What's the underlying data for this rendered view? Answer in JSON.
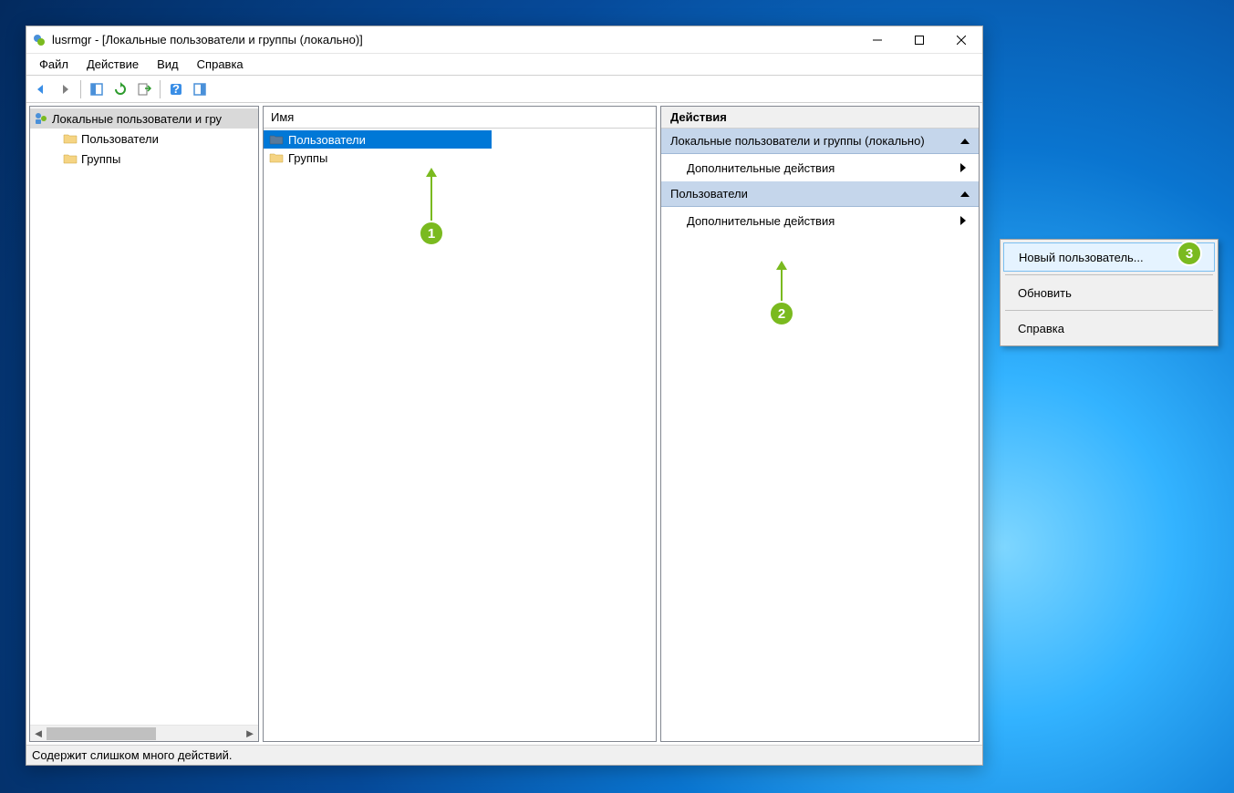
{
  "window": {
    "title": "lusrmgr - [Локальные пользователи и группы (локально)]"
  },
  "menubar": {
    "file": "Файл",
    "action": "Действие",
    "view": "Вид",
    "help": "Справка"
  },
  "tree": {
    "root": "Локальные пользователи и гру",
    "users": "Пользователи",
    "groups": "Группы"
  },
  "list": {
    "header_name": "Имя",
    "users": "Пользователи",
    "groups": "Группы"
  },
  "actions": {
    "title": "Действия",
    "group1": "Локальные пользователи и группы (локально)",
    "more1": "Дополнительные действия",
    "group2": "Пользователи",
    "more2": "Дополнительные действия"
  },
  "context_menu": {
    "new_user": "Новый пользователь...",
    "refresh": "Обновить",
    "help": "Справка"
  },
  "statusbar": {
    "text": "Содержит слишком много действий."
  },
  "annotations": {
    "step1": "1",
    "step2": "2",
    "step3": "3"
  }
}
